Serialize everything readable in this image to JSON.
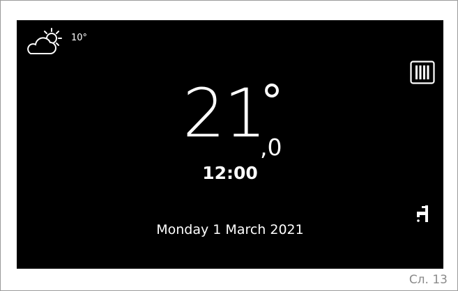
{
  "status": {
    "weather_icon": "partly-cloudy-sun-icon",
    "outdoor_temperature": "10°"
  },
  "heating": {
    "icon": "radiator-icon"
  },
  "room": {
    "temperature_integer": "21",
    "temperature_decimal": ",0",
    "degree_symbol": "°"
  },
  "clock": {
    "time": "12:00"
  },
  "hot_water": {
    "icon": "tap-icon"
  },
  "date": {
    "text": "Monday 1 March 2021"
  },
  "figure": {
    "caption": "Сл. 13"
  },
  "colors": {
    "screen_background": "#000000",
    "screen_foreground": "#ffffff",
    "caption": "#8a8a8a"
  }
}
